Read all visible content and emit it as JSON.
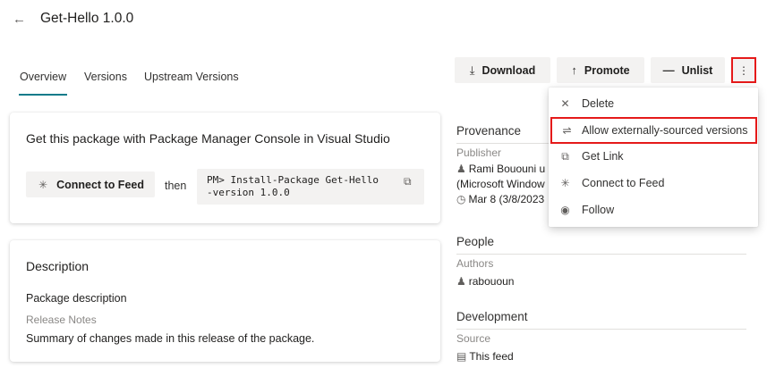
{
  "header": {
    "title": "Get-Hello 1.0.0",
    "back_icon": "arrow-left-icon"
  },
  "tabs": [
    {
      "label": "Overview",
      "active": true
    },
    {
      "label": "Versions",
      "active": false
    },
    {
      "label": "Upstream Versions",
      "active": false
    }
  ],
  "toolbar": {
    "download_label": "Download",
    "promote_label": "Promote",
    "unlist_label": "Unlist",
    "more_icon": "more-vertical-icon"
  },
  "install_card": {
    "heading": "Get this package with Package Manager Console in Visual Studio",
    "connect_label": "Connect to Feed",
    "then_label": "then",
    "command": "PM> Install-Package Get-Hello\n-version 1.0.0"
  },
  "description_card": {
    "heading": "Description",
    "package_description": "Package description",
    "release_notes_label": "Release Notes",
    "release_notes_value": "Summary of changes made in this release of the package."
  },
  "provenance": {
    "title": "Provenance",
    "publisher_label": "Publisher",
    "publisher_line1": "Rami Bououni u",
    "publisher_line2": "(Microsoft Window",
    "date": "Mar 8 (3/8/2023"
  },
  "people": {
    "title": "People",
    "authors_label": "Authors",
    "author": "rabououn"
  },
  "development": {
    "title": "Development",
    "source_label": "Source",
    "source_value": "This feed"
  },
  "menu": {
    "items": [
      {
        "label": "Delete",
        "icon": "close-icon"
      },
      {
        "label": "Allow externally-sourced versions",
        "icon": "sliders-icon",
        "highlighted": true
      },
      {
        "label": "Get Link",
        "icon": "copy-icon"
      },
      {
        "label": "Connect to Feed",
        "icon": "plug-icon"
      },
      {
        "label": "Follow",
        "icon": "eye-icon"
      }
    ]
  },
  "colors": {
    "accent": "#0f7b8a",
    "highlight_border": "#e51a1a"
  }
}
